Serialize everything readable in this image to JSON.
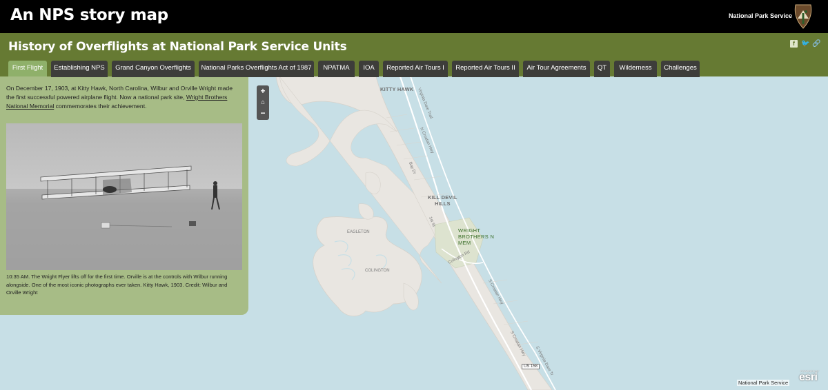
{
  "header": {
    "app_title": "An NPS story map",
    "agency": "National Park Service"
  },
  "story": {
    "title": "History of Overflights at National Park Service Units",
    "tabs": [
      {
        "label": "First Flight",
        "active": true
      },
      {
        "label": "Establishing NPS"
      },
      {
        "label": "Grand Canyon Overflights"
      },
      {
        "label": "National Parks Overflights Act of 1987"
      },
      {
        "label": "NPATMA"
      },
      {
        "label": "IOA"
      },
      {
        "label": "Reported Air Tours I"
      },
      {
        "label": "Reported Air Tours II"
      },
      {
        "label": "Air Tour Agreements"
      },
      {
        "label": "QT"
      },
      {
        "label": "Wilderness"
      },
      {
        "label": "Challenges"
      }
    ],
    "share_icons": [
      "facebook-icon",
      "twitter-icon",
      "link-icon"
    ]
  },
  "panel": {
    "intro_before_link": "On December 17, 1903, at Kitty Hawk, North Carolina, Wilbur and Orville Wright made the first successful powered airplane flight. Now a national park site, ",
    "intro_link": "Wright Brothers National Memorial",
    "intro_after_link": " commemorates their achievement.",
    "caption": "10:35 AM. The Wright Flyer lifts off for the first time. Orville is at the controls with Wilbur running alongside. One of the most iconic photographs ever taken. Kitty Hawk, 1903. Credit: Wilbur and Orville Wright"
  },
  "map": {
    "controls": {
      "zoom_in": "+",
      "home": "⌂",
      "zoom_out": "−"
    },
    "places": {
      "kitty_hawk": "KITTY HAWK",
      "kill_devil": "KILL DEVIL HILLS",
      "kill_devil_l1": "KILL DEVIL",
      "kill_devil_l2": "HILLS",
      "wright_l1": "WRIGHT",
      "wright_l2": "BROTHERS N",
      "wright_l3": "MEM",
      "colington": "COLINGTON",
      "eagleton": "EAGLETON"
    },
    "roads": {
      "virginia_dare_1": "Virginia Dare Trail",
      "croatan_1": "N Croatan Hwy",
      "bay_dr": "Bay Dr",
      "first_st": "1st St",
      "colington_rd": "Colington Rd",
      "croatan_2": "S Croatan Hwy",
      "croatan_3": "S Croatan Hwy",
      "virginia_dare_2": "S Virginia Dare Tr",
      "us158": "US 158"
    },
    "attribution": "National Park Service",
    "powered_by": "POWERED BY",
    "esri": "esri",
    "colors": {
      "water": "#c7dfe6",
      "land": "#e9e6e1",
      "park": "#dde3cf",
      "panel": "#a7bc86",
      "header_green": "#667a33"
    }
  }
}
